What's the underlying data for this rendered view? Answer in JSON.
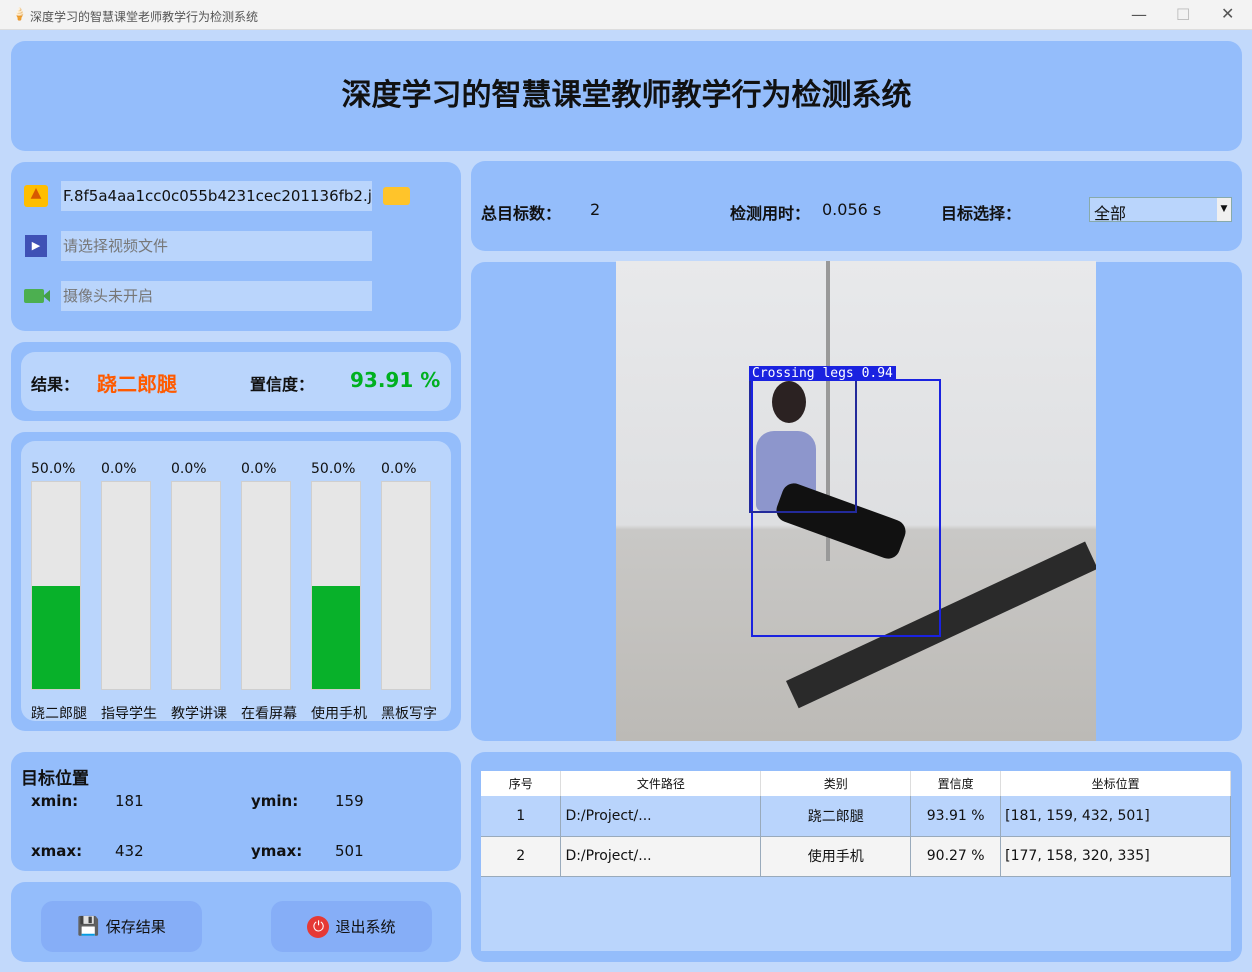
{
  "window": {
    "title": "深度学习的智慧课堂老师教学行为检测系统"
  },
  "header": {
    "title": "深度学习的智慧课堂教师教学行为检测系统"
  },
  "inputs": {
    "image_path": "F.8f5a4aa1cc0c055b4231cec201136fb2.jpg",
    "video_placeholder": "请选择视频文件",
    "camera_placeholder": "摄像头未开启"
  },
  "result": {
    "label": "结果：",
    "value": "跷二郎腿",
    "conf_label": "置信度：",
    "conf_value": "93.91 %",
    "value_color": "#ff5a00",
    "conf_color": "#00b020"
  },
  "bars": [
    {
      "pct": "50.0%",
      "value": 50,
      "label": "跷二郎腿"
    },
    {
      "pct": "0.0%",
      "value": 0,
      "label": "指导学生"
    },
    {
      "pct": "0.0%",
      "value": 0,
      "label": "教学讲课"
    },
    {
      "pct": "0.0%",
      "value": 0,
      "label": "在看屏幕"
    },
    {
      "pct": "50.0%",
      "value": 50,
      "label": "使用手机"
    },
    {
      "pct": "0.0%",
      "value": 0,
      "label": "黑板写字"
    }
  ],
  "position": {
    "title": "目标位置",
    "xmin_label": "xmin:",
    "xmin": "181",
    "ymin_label": "ymin:",
    "ymin": "159",
    "xmax_label": "xmax:",
    "xmax": "432",
    "ymax_label": "ymax:",
    "ymax": "501"
  },
  "buttons": {
    "save": "保存结果",
    "exit": "退出系统"
  },
  "stats": {
    "total_label": "总目标数：",
    "total": "2",
    "time_label": "检测用时：",
    "time": "0.056 s",
    "select_label": "目标选择：",
    "select_value": "全部"
  },
  "detection": {
    "box_label": "Crossing legs 0.94"
  },
  "table": {
    "headers": [
      "序号",
      "文件路径",
      "类别",
      "置信度",
      "坐标位置"
    ],
    "rows": [
      [
        "1",
        "D:/Project/...",
        "跷二郎腿",
        "93.91 %",
        "[181, 159, 432, 501]"
      ],
      [
        "2",
        "D:/Project/...",
        "使用手机",
        "90.27 %",
        "[177, 158, 320, 335]"
      ]
    ]
  }
}
